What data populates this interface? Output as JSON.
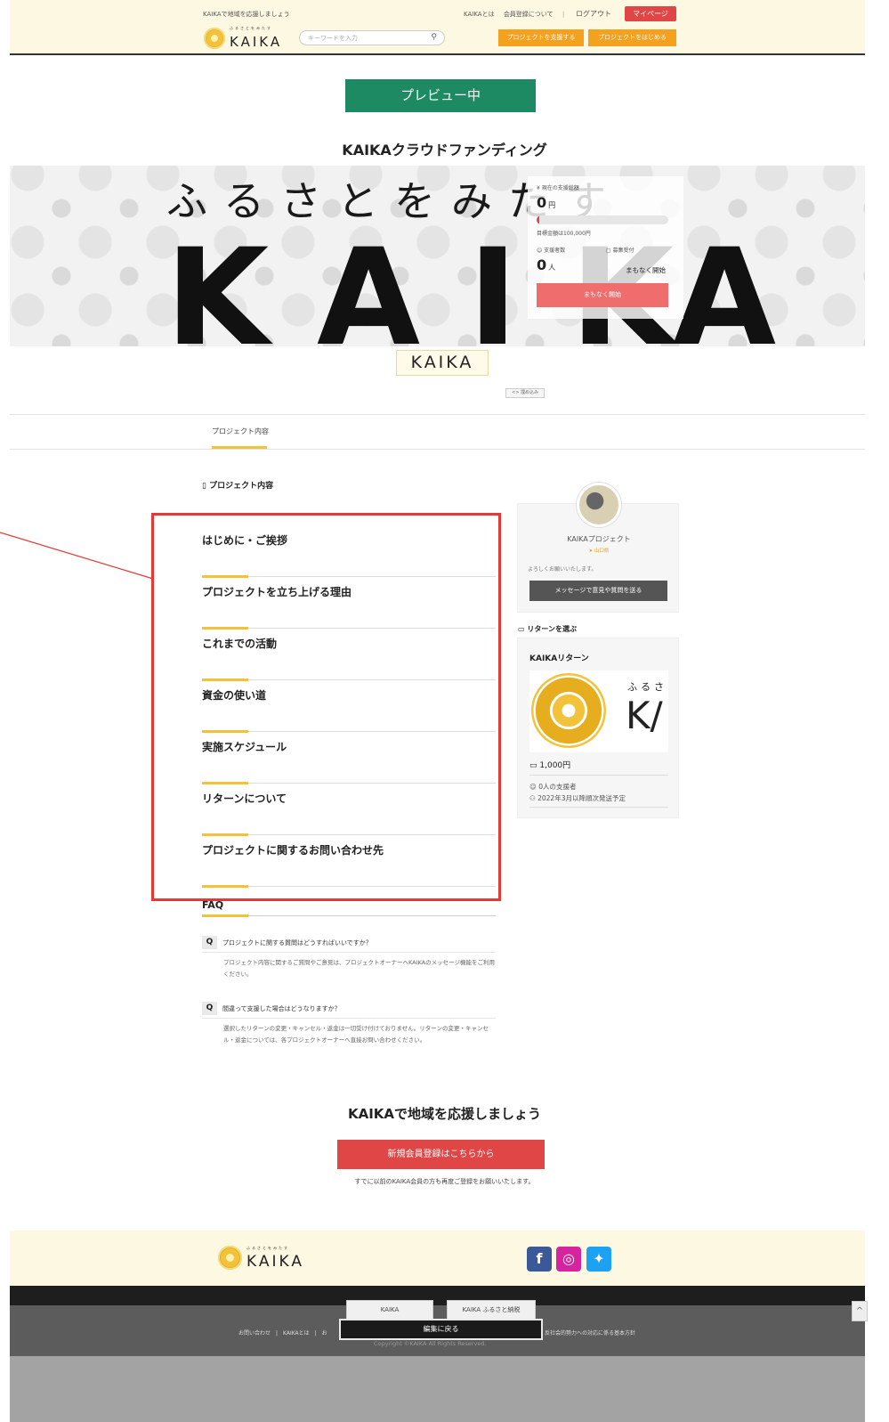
{
  "header": {
    "tagline": "KAIKAで地域を応援しましょう",
    "links": [
      "KAIKAとは",
      "会員登録について"
    ],
    "logout": "ログアウト",
    "mypage": "マイページ",
    "logo_kana": "ふるさとをみたす",
    "logo_text": "KAIKA",
    "search_placeholder": "キーワードを入力",
    "support_btn": "プロジェクトを支援する",
    "start_btn": "プロジェクトをはじめる"
  },
  "preview_label": "プレビュー中",
  "project_title": "KAIKAクラウドファンディング",
  "hero": {
    "top_text": "ふるさとをみたす",
    "big_letters": [
      "K",
      "A",
      "I",
      "K",
      "A"
    ],
    "sub_logo": "KAIKA",
    "embed_label": "<> 埋め込み"
  },
  "stats": {
    "total_label": "¥ 現在の支援総額",
    "total_value": "0",
    "total_unit": "円",
    "progress_percent": 0,
    "goal": "目標金額は100,000円",
    "supporters_label": "☺ 支援者数",
    "supporters_value": "0",
    "supporters_unit": "人",
    "period_label": "募集受付",
    "period_value": "まもなく開始",
    "button": "まもなく開始"
  },
  "tab": "プロジェクト内容",
  "section_heading": "プロジェクト内容",
  "content_headings": [
    "はじめに・ご挨拶",
    "プロジェクトを立ち上げる理由",
    "これまでの活動",
    "資金の使い道",
    "実施スケジュール",
    "リターンについて",
    "プロジェクトに関するお問い合わせ先"
  ],
  "faq": {
    "heading": "FAQ",
    "items": [
      {
        "q": "プロジェクトに関する質問はどうすればいいですか？",
        "a": "プロジェクト内容に関するご質問やご意見は、プロジェクトオーナーへKAIKAのメッセージ機能をご利用ください。"
      },
      {
        "q": "間違って支援した場合はどうなりますか？",
        "a": "選択したリターンの変更・キャンセル・返金は一切受け付けておりません。リターンの変更・キャンセル・返金については、各プロジェクトオーナーへ直接お問い合わせください。"
      }
    ]
  },
  "owner": {
    "name": "KAIKAプロジェクト",
    "location": "山口県",
    "greeting": "よろしくお願いいたします。",
    "message_btn": "メッセージで意見や質問を送る"
  },
  "returns": {
    "heading": "リターンを選ぶ",
    "card_title": "KAIKAリターン",
    "card_img_text": "ふるさ",
    "card_img_big": "K/",
    "price": "1,000円",
    "supporters": "0人の支援者",
    "shipping": "2022年3月以降順次発送予定"
  },
  "cta": {
    "heading": "KAIKAで地域を応援しましょう",
    "button": "新規会員登録はこちらから",
    "note": "すでに以前のKAIKA会員の方も再度ご登録をお願いいたします。"
  },
  "footer": {
    "logo_kana": "ふるさとをみたす",
    "logo_text": "KAIKA",
    "badge1": "KAIKA",
    "badge2": "KAIKA ふるさと納税",
    "links_left": "お問い合わせ　|　KAIKAとは　|　お",
    "links_right": "反社会的勢力への対応に係る基本方針",
    "copyright": "Copyright ©KAIKA All Rights Reserved.",
    "back_to_edit": "編集に戻る",
    "to_top": "^"
  },
  "colors": {
    "header_bg": "#fdf8e1",
    "preview_green": "#1e8a63",
    "accent_red": "#e04646",
    "accent_orange": "#f3a11f",
    "underline_yellow": "#f2c23a",
    "annotation_red": "#e53935"
  },
  "icons": [
    "search-icon",
    "document-icon",
    "gift-icon",
    "smiley-icon",
    "user-icon",
    "location-icon",
    "facebook-icon",
    "instagram-icon",
    "twitter-icon",
    "chevron-up-icon"
  ]
}
